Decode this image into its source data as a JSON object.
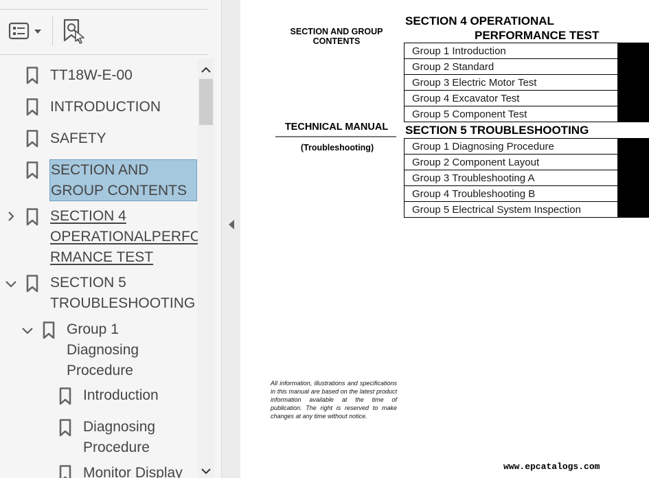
{
  "sidebar": {
    "toolbar": {
      "options_icon": "options-menu-icon",
      "find_icon": "find-current-bookmark-icon"
    },
    "bookmarks": [
      {
        "label": "TT18W-E-00",
        "expander": "none",
        "selected": false,
        "link": false
      },
      {
        "label": "INTRODUCTION",
        "expander": "none",
        "selected": false,
        "link": false
      },
      {
        "label": "SAFETY",
        "expander": "none",
        "selected": false,
        "link": false
      },
      {
        "label_lines": [
          "SECTION AND",
          "GROUP CONTENTS"
        ],
        "expander": "none",
        "selected": true,
        "link": false
      },
      {
        "label_lines": [
          "SECTION 4",
          "OPERATIONALPERFO",
          "RMANCE TEST"
        ],
        "expander": "collapsed",
        "selected": false,
        "link": true
      },
      {
        "label_lines": [
          "SECTION 5",
          "TROUBLESHOOTING"
        ],
        "expander": "expanded",
        "selected": false,
        "link": false
      },
      {
        "label_lines": [
          "Group 1",
          "Diagnosing",
          "Procedure"
        ],
        "expander": "expanded",
        "selected": false,
        "link": false
      },
      {
        "label": "Introduction",
        "expander": "none",
        "selected": false,
        "link": false
      },
      {
        "label_lines": [
          "Diagnosing",
          "Procedure"
        ],
        "expander": "none",
        "selected": false,
        "link": false
      },
      {
        "label": "Monitor Display",
        "expander": "none",
        "selected": false,
        "link": false
      }
    ],
    "colors": {
      "selected_bg": "#a6c8de",
      "panel_bg": "#f5f5f5",
      "text": "#454545"
    }
  },
  "document": {
    "left_col": {
      "section_group_contents_lines": [
        "SECTION AND GROUP",
        "CONTENTS"
      ],
      "technical_manual": "TECHNICAL MANUAL",
      "technical_manual_sub": "(Troubleshooting)",
      "disclaimer": "All information, illustrations and specifications in this manual are based on the latest product information available at the time of publication. The right is reserved to make changes at any time without notice."
    },
    "section4": {
      "title_line1": "SECTION 4 OPERATIONAL",
      "title_line2": "PERFORMANCE TEST",
      "groups": [
        "Group 1 Introduction",
        "Group 2 Standard",
        "Group 3 Electric Motor Test",
        "Group 4 Excavator Test",
        "Group 5 Component Test"
      ]
    },
    "section5": {
      "title": "SECTION 5 TROUBLESHOOTING",
      "groups": [
        "Group 1 Diagnosing Procedure",
        "Group 2 Component Layout",
        "Group 3 Troubleshooting A",
        "Group 4 Troubleshooting B",
        "Group 5 Electrical System Inspection"
      ]
    },
    "watermark": "www.epcatalogs.com"
  }
}
